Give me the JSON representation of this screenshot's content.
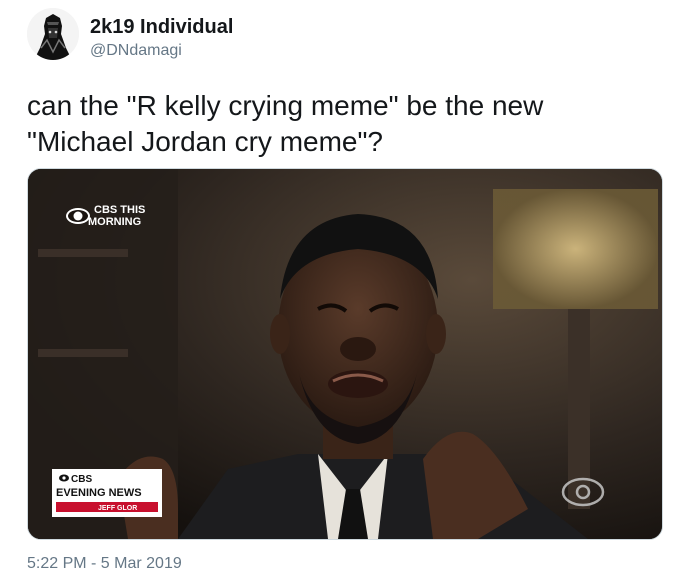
{
  "author": {
    "display_name": "2k19 Individual",
    "handle": "@DNdamagi"
  },
  "tweet": {
    "text_line_1": "can the \"R kelly crying meme\" be the new",
    "text_line_2": "\"Michael Jordan cry meme\"?",
    "timestamp": "5:22 PM - 5 Mar 2019"
  },
  "media": {
    "network_logo_line_1": "CBS THIS",
    "network_logo_line_2": "MORNING",
    "lower_third_line_1": "CBS",
    "lower_third_line_2": "EVENING NEWS",
    "lower_third_line_3": "JEFF GLOR"
  },
  "icons": {
    "avatar": "pharaoh-headdress-avatar",
    "cbs_eye": "cbs-eye-icon"
  },
  "colors": {
    "text_primary": "#14171a",
    "text_secondary": "#657786"
  }
}
